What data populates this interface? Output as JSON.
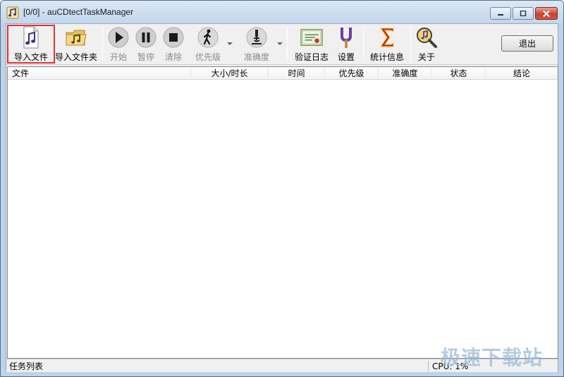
{
  "window": {
    "title": "[0/0] - auCDtectTaskManager",
    "app_icon": "music-note-icon"
  },
  "toolbar": {
    "buttons": [
      {
        "label": "导入文件",
        "icon": "music-file-icon",
        "enabled": true
      },
      {
        "label": "导入文件夹",
        "icon": "music-folder-icon",
        "enabled": true
      },
      {
        "label": "开始",
        "icon": "play-icon",
        "enabled": false
      },
      {
        "label": "暂停",
        "icon": "pause-icon",
        "enabled": false
      },
      {
        "label": "清除",
        "icon": "stop-icon",
        "enabled": false
      },
      {
        "label": "优先级",
        "icon": "walking-person-icon",
        "enabled": false
      },
      {
        "label": "准确度",
        "icon": "microscope-icon",
        "enabled": false
      },
      {
        "label": "验证日志",
        "icon": "log-certificate-icon",
        "enabled": true
      },
      {
        "label": "设置",
        "icon": "tuning-fork-icon",
        "enabled": true
      },
      {
        "label": "统计信息",
        "icon": "sigma-icon",
        "enabled": true
      },
      {
        "label": "关于",
        "icon": "magnifier-note-icon",
        "enabled": true
      }
    ],
    "exit_label": "退出"
  },
  "list": {
    "columns": [
      "文件",
      "大小/时长",
      "时间",
      "优先级",
      "准确度",
      "状态",
      "结论"
    ],
    "rows": []
  },
  "status": {
    "left": "任务列表",
    "cpu": "CPU: 1%"
  },
  "watermark": "极速下载站",
  "colors": {
    "highlight": "#e03434",
    "disabled_text": "#8c8c8c"
  }
}
